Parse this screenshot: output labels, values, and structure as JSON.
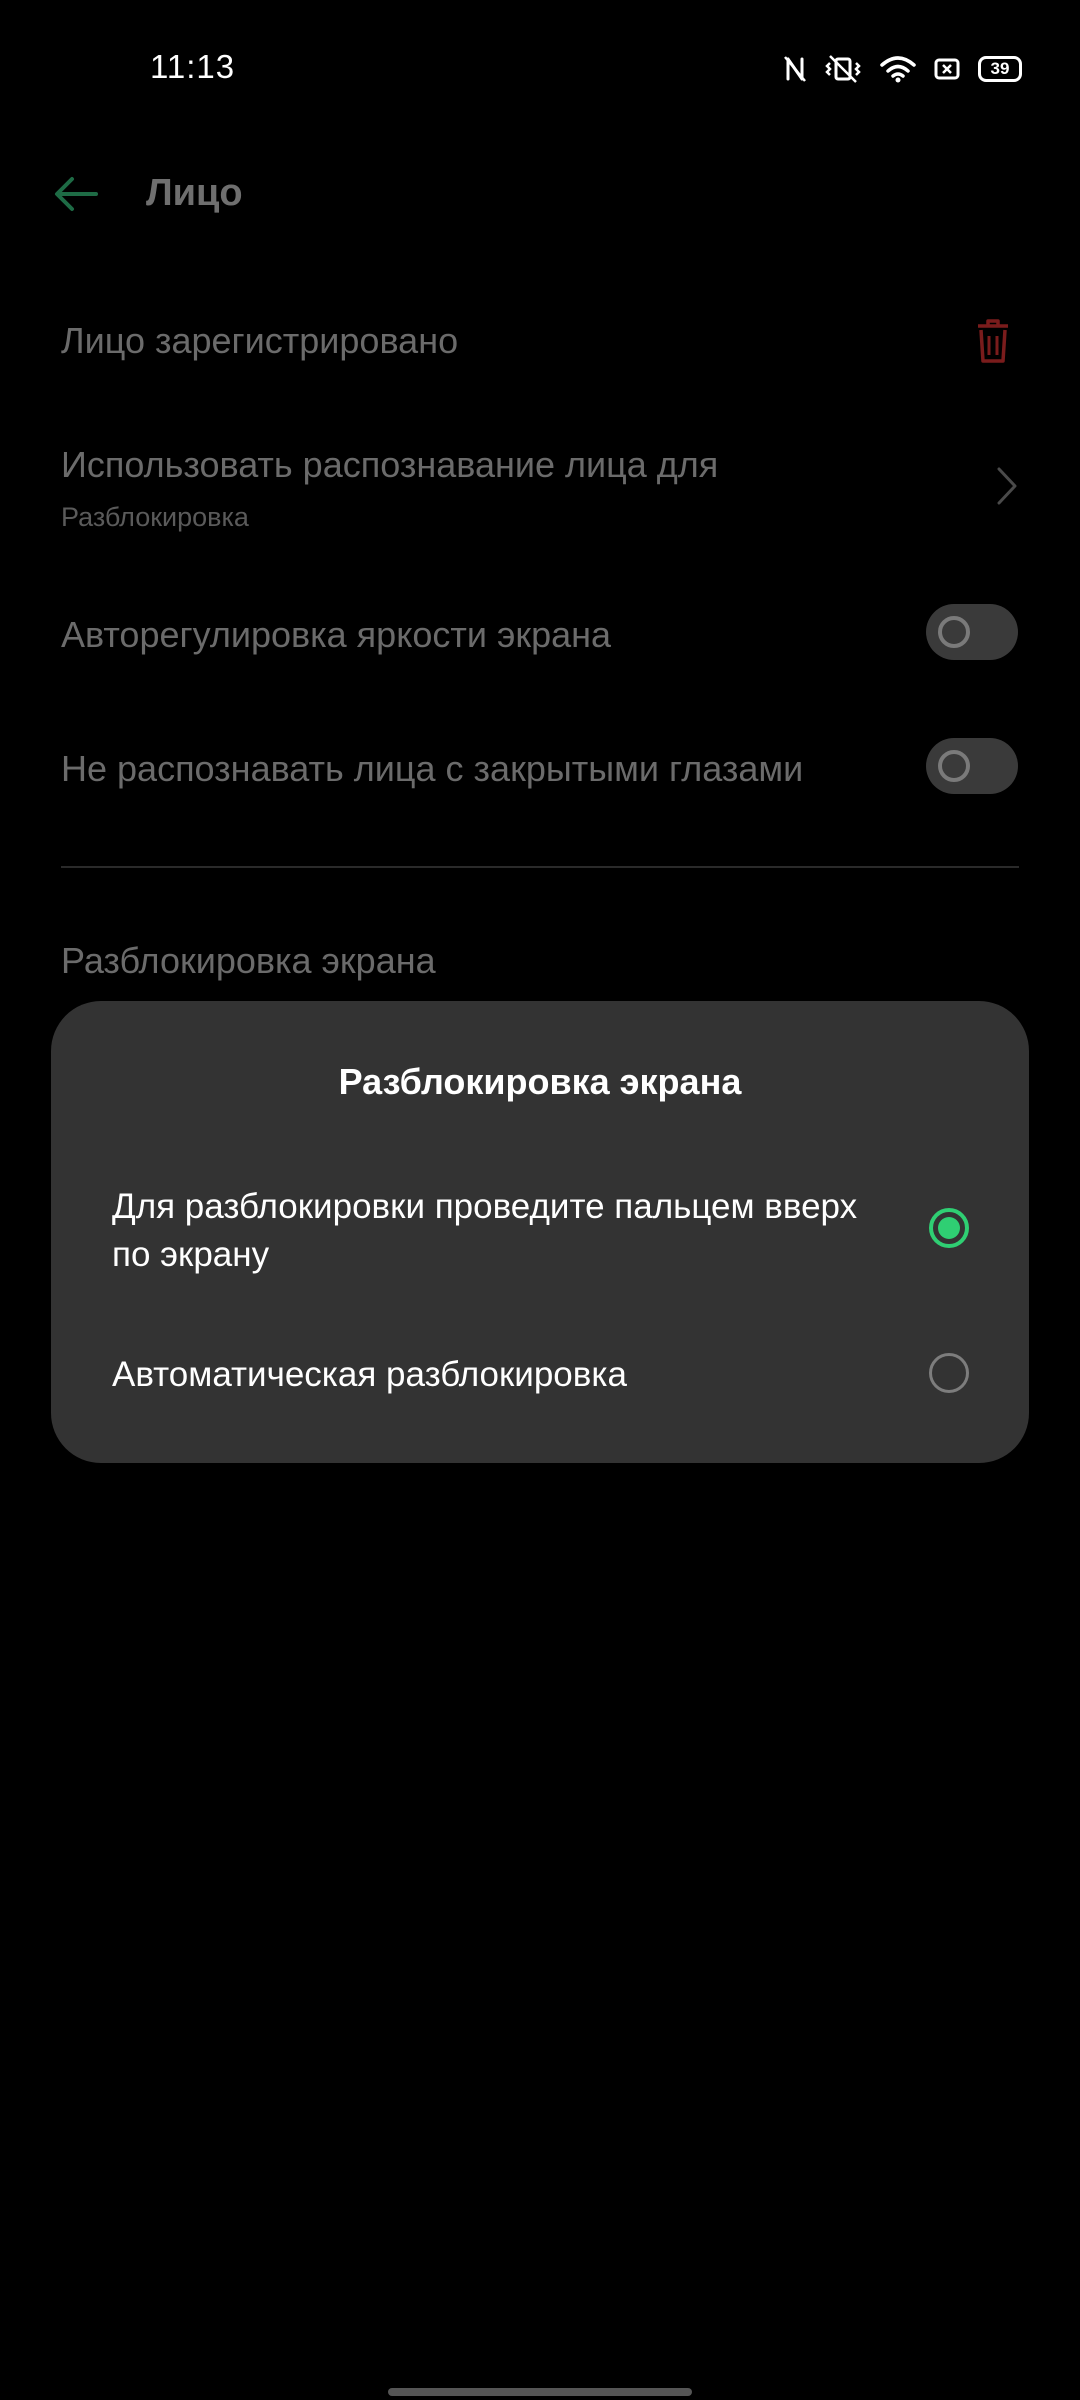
{
  "status_bar": {
    "time": "11:13",
    "icons": [
      "nfc-icon",
      "vibrate-icon",
      "wifi-icon",
      "sim-icon",
      "battery-icon"
    ],
    "battery_level": "39"
  },
  "header": {
    "back_icon": "arrow-left-icon",
    "title": "Лицо"
  },
  "settings": {
    "face_registered": "Лицо зарегистрировано",
    "use_face_for_label": "Использовать распознавание лица для",
    "use_face_for_value": "Разблокировка",
    "auto_brightness_label": "Авторегулировка яркости экрана",
    "auto_brightness_on": false,
    "closed_eyes_label": "Не распознавать лица с закрытыми глазами",
    "closed_eyes_on": false,
    "screen_unlock_label": "Разблокировка экрана"
  },
  "dialog": {
    "title": "Разблокировка экрана",
    "options": [
      {
        "label": "Для разблокировки проведите пальцем вверх по экрану",
        "selected": true
      },
      {
        "label": "Автоматическая разблокировка",
        "selected": false
      }
    ]
  },
  "colors": {
    "accent": "#2fcf73",
    "dialog_bg": "#333333",
    "delete": "#8a1f1f"
  }
}
